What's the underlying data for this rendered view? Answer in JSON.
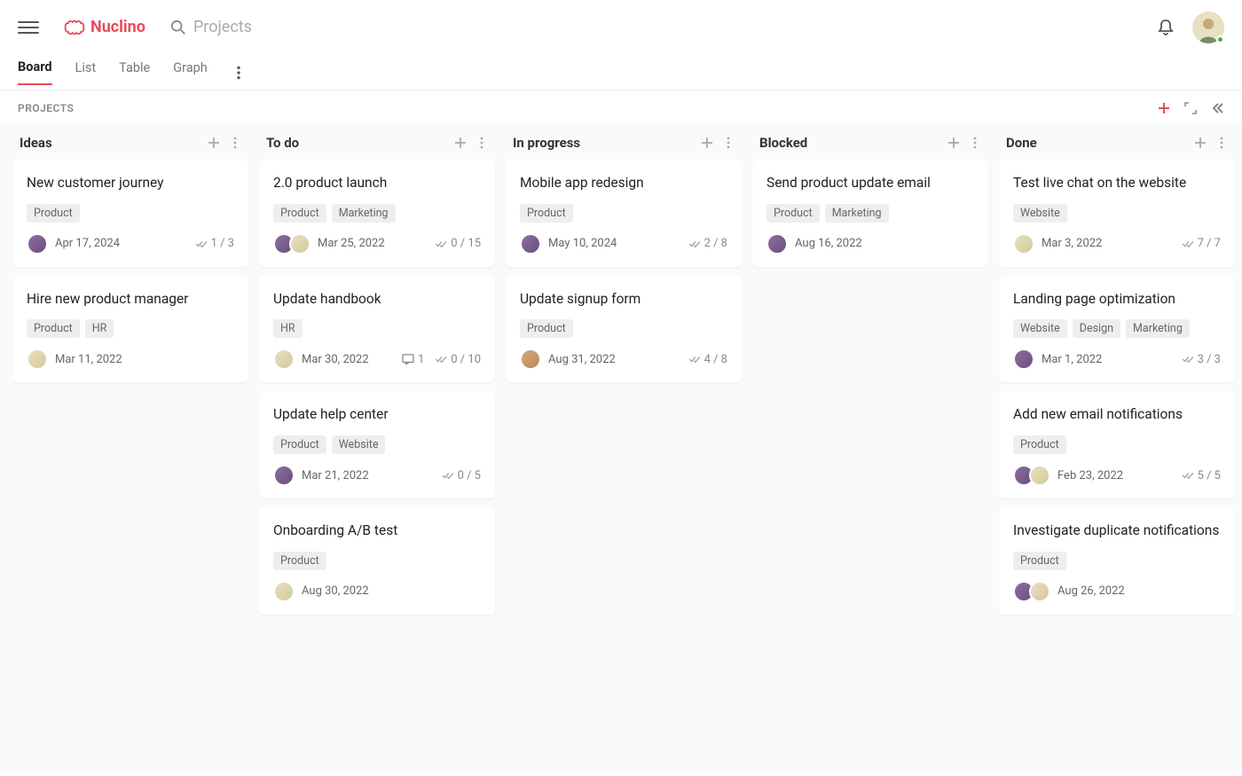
{
  "brand": "Nuclino",
  "searchPlaceholder": "Projects",
  "tabs": [
    "Board",
    "List",
    "Table",
    "Graph"
  ],
  "activeTab": 0,
  "subheaderTitle": "PROJECTS",
  "columns": [
    {
      "title": "Ideas",
      "cards": [
        {
          "title": "New customer journey",
          "tags": [
            "Product"
          ],
          "avatars": [
            "a1"
          ],
          "date": "Apr 17, 2024",
          "progress": "1 / 3"
        },
        {
          "title": "Hire new product manager",
          "tags": [
            "Product",
            "HR"
          ],
          "avatars": [
            "a2"
          ],
          "date": "Mar 11, 2022"
        }
      ]
    },
    {
      "title": "To do",
      "cards": [
        {
          "title": "2.0 product launch",
          "tags": [
            "Product",
            "Marketing"
          ],
          "avatars": [
            "a1",
            "a2"
          ],
          "date": "Mar 25, 2022",
          "progress": "0 / 15"
        },
        {
          "title": "Update handbook",
          "tags": [
            "HR"
          ],
          "avatars": [
            "a2"
          ],
          "date": "Mar 30, 2022",
          "comments": "1",
          "progress": "0 / 10"
        },
        {
          "title": "Update help center",
          "tags": [
            "Product",
            "Website"
          ],
          "avatars": [
            "a1"
          ],
          "date": "Mar 21, 2022",
          "progress": "0 / 5"
        },
        {
          "title": "Onboarding A/B test",
          "tags": [
            "Product"
          ],
          "avatars": [
            "a2"
          ],
          "date": "Aug 30, 2022"
        }
      ]
    },
    {
      "title": "In progress",
      "cards": [
        {
          "title": "Mobile app redesign",
          "tags": [
            "Product"
          ],
          "avatars": [
            "a1"
          ],
          "date": "May 10, 2024",
          "progress": "2 / 8"
        },
        {
          "title": "Update signup form",
          "tags": [
            "Product"
          ],
          "avatars": [
            "a3"
          ],
          "date": "Aug 31, 2022",
          "progress": "4 / 8"
        }
      ]
    },
    {
      "title": "Blocked",
      "cards": [
        {
          "title": "Send product update email",
          "tags": [
            "Product",
            "Marketing"
          ],
          "avatars": [
            "a1"
          ],
          "date": "Aug 16, 2022"
        }
      ]
    },
    {
      "title": "Done",
      "cards": [
        {
          "title": "Test live chat on the website",
          "tags": [
            "Website"
          ],
          "avatars": [
            "a2"
          ],
          "date": "Mar 3, 2022",
          "progress": "7 / 7"
        },
        {
          "title": "Landing page optimization",
          "tags": [
            "Website",
            "Design",
            "Marketing"
          ],
          "avatars": [
            "a1"
          ],
          "date": "Mar 1, 2022",
          "progress": "3 / 3"
        },
        {
          "title": "Add new email notifications",
          "tags": [
            "Product"
          ],
          "avatars": [
            "a1",
            "a2"
          ],
          "date": "Feb 23, 2022",
          "progress": "5 / 5"
        },
        {
          "title": "Investigate duplicate notifications",
          "tags": [
            "Product"
          ],
          "avatars": [
            "a1",
            "a2"
          ],
          "date": "Aug 26, 2022"
        }
      ]
    }
  ]
}
